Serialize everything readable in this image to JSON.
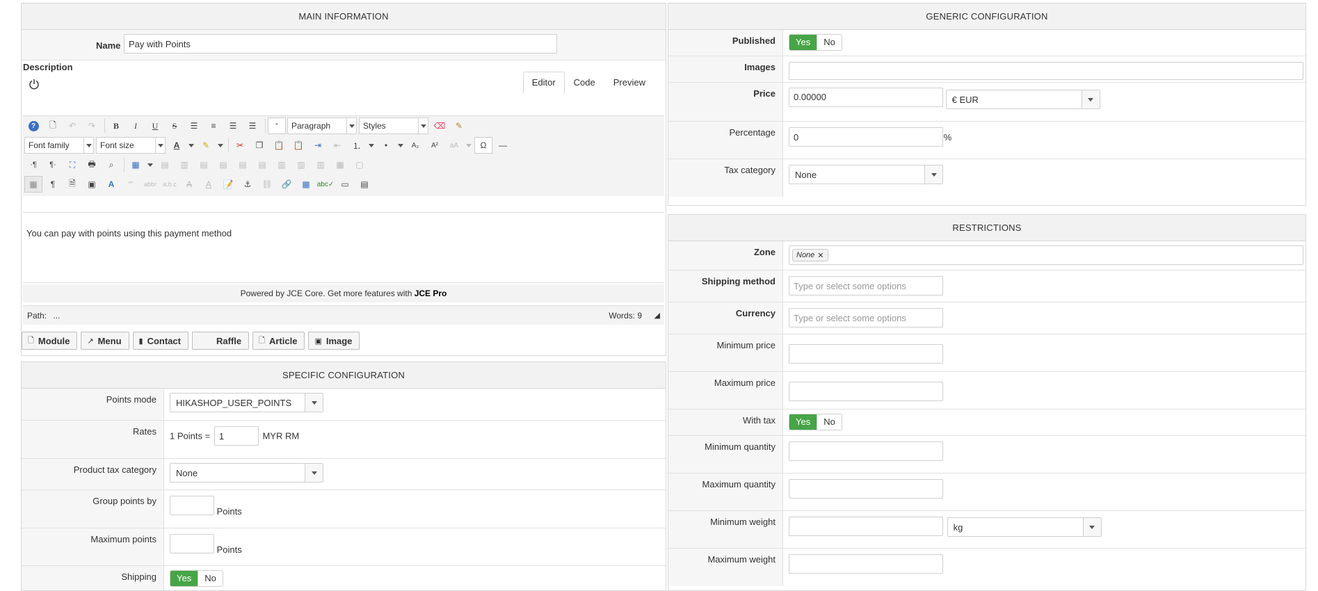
{
  "main_info": {
    "title": "MAIN INFORMATION",
    "name_label": "Name",
    "name_value": "Pay with Points",
    "description_label": "Description",
    "tabs": [
      "Editor",
      "Code",
      "Preview"
    ],
    "toolbar": {
      "format_select": "Paragraph",
      "styles_select": "Styles",
      "font_family": "Font family",
      "font_size": "Font size"
    },
    "editor_text": "You can pay with points using this payment method",
    "powered_text": "Powered by JCE Core. Get more features with ",
    "powered_pro": "JCE Pro",
    "path_label": "Path:",
    "path_value": "...",
    "words": "Words: 9",
    "buttons": [
      "Module",
      "Menu",
      "Contact",
      "Raffle",
      "Article",
      "Image"
    ]
  },
  "specific": {
    "title": "SPECIFIC CONFIGURATION",
    "points_mode_label": "Points mode",
    "points_mode_value": "HIKASHOP_USER_POINTS",
    "rates_label": "Rates",
    "rates_prefix": "1 Points =",
    "rates_value": "1",
    "rates_suffix": "MYR RM",
    "product_tax_label": "Product tax category",
    "product_tax_value": "None",
    "group_points_label": "Group points by",
    "group_points_unit": "Points",
    "max_points_label": "Maximum points",
    "max_points_unit": "Points",
    "shipping_label": "Shipping",
    "yes": "Yes",
    "no": "No"
  },
  "generic": {
    "title": "GENERIC CONFIGURATION",
    "published_label": "Published",
    "images_label": "Images",
    "price_label": "Price",
    "price_value": "0.00000",
    "currency_value": "€ EUR",
    "percentage_label": "Percentage",
    "percentage_value": "0",
    "percent_sign": "%",
    "tax_category_label": "Tax category",
    "tax_category_value": "None",
    "yes": "Yes",
    "no": "No"
  },
  "restrictions": {
    "title": "RESTRICTIONS",
    "zone_label": "Zone",
    "zone_chip": "None",
    "shipping_method_label": "Shipping method",
    "shipping_method_placeholder": "Type or select some options",
    "currency_label": "Currency",
    "currency_placeholder": "Type or select some options",
    "min_price_label": "Minimum price",
    "max_price_label": "Maximum price",
    "with_tax_label": "With tax",
    "min_qty_label": "Minimum quantity",
    "max_qty_label": "Maximum quantity",
    "min_weight_label": "Minimum weight",
    "weight_unit": "kg",
    "max_weight_label": "Maximum weight",
    "yes": "Yes",
    "no": "No"
  },
  "colors": {
    "accent_green": "#46a546",
    "panel_header": "#f2f2f2",
    "border": "#d7d7d7"
  }
}
